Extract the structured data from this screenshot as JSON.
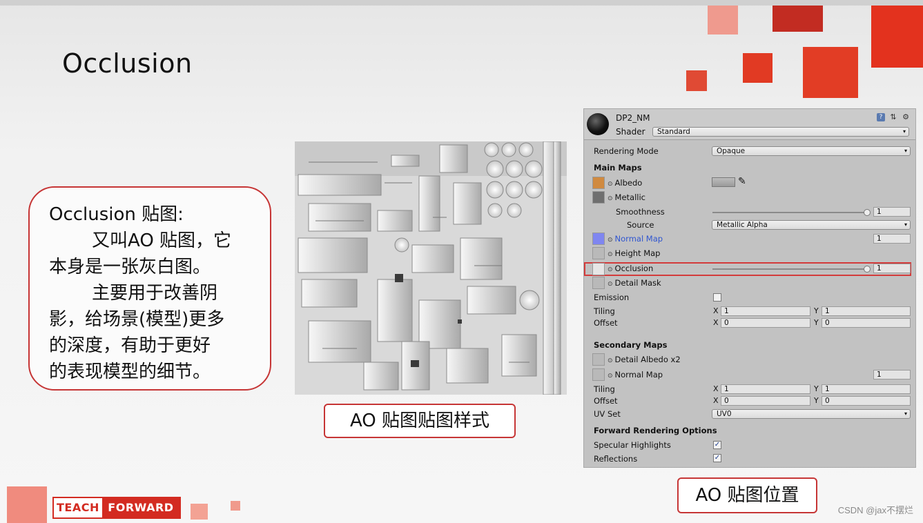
{
  "slide": {
    "title": "Occlusion",
    "callout": {
      "heading": "Occlusion 贴图:",
      "line1": "又叫AO 贴图，它",
      "line2": "本身是一张灰白图。",
      "line3": "主要用于改善阴",
      "line4": "影，给场景(模型)更多",
      "line5": "的深度，有助于更好",
      "line6": "的表现模型的细节。"
    },
    "ao_caption": "AO 贴图贴图样式",
    "position_caption": "AO 贴图位置",
    "logo": {
      "part1": "TEACH",
      "part2": "FORWARD"
    },
    "watermark": "CSDN @jax不摆烂",
    "accent_color": "#d32b21"
  },
  "inspector": {
    "material_name": "DP2_NM",
    "shader_label": "Shader",
    "shader_value": "Standard",
    "rendering_mode_label": "Rendering Mode",
    "rendering_mode_value": "Opaque",
    "main_maps_header": "Main Maps",
    "albedo_label": "Albedo",
    "metallic_label": "Metallic",
    "smoothness_label": "Smoothness",
    "smoothness_value": "1",
    "source_label": "Source",
    "source_value": "Metallic Alpha",
    "normal_map_label": "Normal Map",
    "normal_map_value": "1",
    "height_map_label": "Height Map",
    "occlusion_label": "Occlusion",
    "occlusion_value": "1",
    "detail_mask_label": "Detail Mask",
    "emission_label": "Emission",
    "tiling_label": "Tiling",
    "offset_label": "Offset",
    "x_label": "X",
    "y_label": "Y",
    "main_tiling_x": "1",
    "main_tiling_y": "1",
    "main_offset_x": "0",
    "main_offset_y": "0",
    "secondary_maps_header": "Secondary Maps",
    "detail_albedo_label": "Detail Albedo x2",
    "sec_normal_map_label": "Normal Map",
    "sec_normal_map_value": "1",
    "sec_tiling_x": "1",
    "sec_tiling_y": "1",
    "sec_offset_x": "0",
    "sec_offset_y": "0",
    "uv_set_label": "UV Set",
    "uv_set_value": "UV0",
    "forward_header": "Forward Rendering Options",
    "specular_label": "Specular Highlights",
    "reflections_label": "Reflections",
    "icons": [
      "help-icon",
      "preset-icon",
      "settings-icon"
    ]
  }
}
